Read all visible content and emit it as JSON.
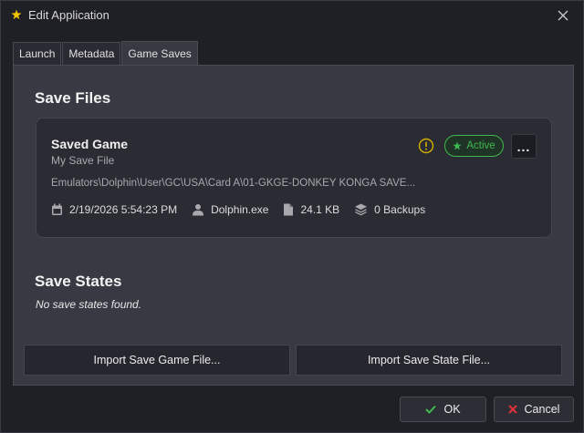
{
  "window": {
    "title": "Edit Application",
    "icon": "star-app-icon",
    "accent_color": "#f5c400"
  },
  "tabs": [
    {
      "label": "Launch",
      "active": false
    },
    {
      "label": "Metadata",
      "active": false
    },
    {
      "label": "Game Saves",
      "active": true
    }
  ],
  "save_files": {
    "heading": "Save Files",
    "card": {
      "title": "Saved Game",
      "subtitle": "My Save File",
      "path": "Emulators\\Dolphin\\User\\GC\\USA\\Card A\\01-GKGE-DONKEY KONGA SAVE...",
      "badge": "Active",
      "badge_color": "#3fb950",
      "warning_color": "#d4b000",
      "more_label": "...",
      "date": "2/19/2026 5:54:23 PM",
      "emulator": "Dolphin.exe",
      "size": "24.1 KB",
      "backups": "0 Backups"
    }
  },
  "save_states": {
    "heading": "Save States",
    "empty_message": "No save states found."
  },
  "actions": {
    "import_save_game": "Import Save Game File...",
    "import_save_state": "Import Save State File..."
  },
  "footer": {
    "ok_label": "OK",
    "ok_color": "#3fb950",
    "cancel_label": "Cancel",
    "cancel_color": "#e0303a"
  }
}
